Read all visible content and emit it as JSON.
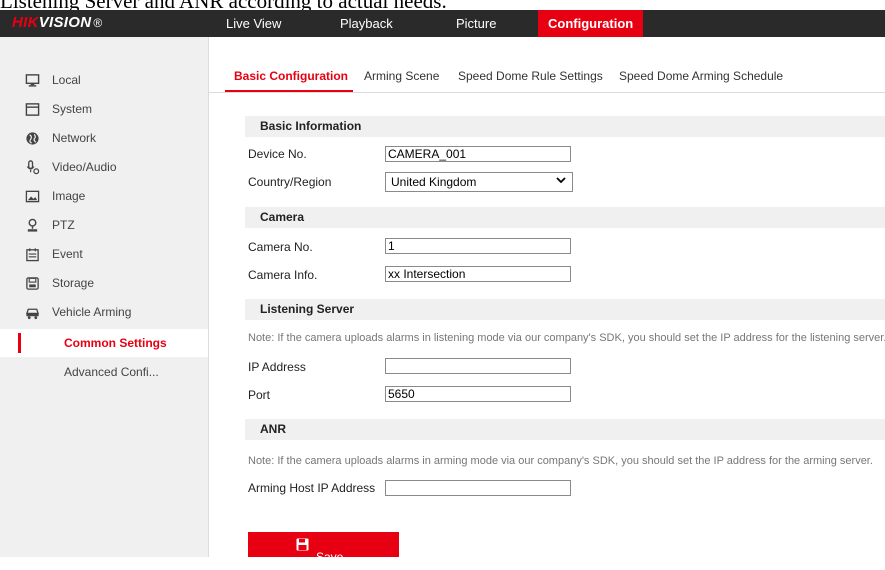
{
  "caption": "Listening Server and ANR according to actual needs.",
  "brand": {
    "logo_red": "HIK",
    "logo_white": "VISION",
    "reg": "®"
  },
  "topnav": [
    {
      "label": "Live View"
    },
    {
      "label": "Playback"
    },
    {
      "label": "Picture"
    },
    {
      "label": "Configuration",
      "active": true
    }
  ],
  "sidebar": {
    "items": [
      {
        "label": "Local",
        "icon": "monitor-icon"
      },
      {
        "label": "System",
        "icon": "system-icon"
      },
      {
        "label": "Network",
        "icon": "globe-icon"
      },
      {
        "label": "Video/Audio",
        "icon": "microphone-icon"
      },
      {
        "label": "Image",
        "icon": "image-icon"
      },
      {
        "label": "PTZ",
        "icon": "ptz-icon"
      },
      {
        "label": "Event",
        "icon": "calendar-icon"
      },
      {
        "label": "Storage",
        "icon": "storage-icon"
      },
      {
        "label": "Vehicle Arming",
        "icon": "vehicle-icon"
      }
    ],
    "subitems": [
      {
        "label": "Common Settings",
        "active": true
      },
      {
        "label": "Advanced Confi..."
      }
    ]
  },
  "tabs": [
    {
      "label": "Basic Configuration",
      "active": true
    },
    {
      "label": "Arming Scene"
    },
    {
      "label": "Speed Dome Rule Settings"
    },
    {
      "label": "Speed Dome Arming Schedule"
    }
  ],
  "basic_info": {
    "title": "Basic Information",
    "device_no_label": "Device No.",
    "device_no_value": "CAMERA_001",
    "country_label": "Country/Region",
    "country_value": "United Kingdom"
  },
  "camera": {
    "title": "Camera",
    "camera_no_label": "Camera No.",
    "camera_no_value": "1",
    "camera_info_label": "Camera Info.",
    "camera_info_value": "xx Intersection"
  },
  "listening_server": {
    "title": "Listening Server",
    "note": "Note: If the camera uploads alarms in listening mode via our company's SDK, you should set the IP address for the listening server.",
    "ip_label": "IP Address",
    "ip_value": "",
    "port_label": "Port",
    "port_value": "5650"
  },
  "anr": {
    "title": "ANR",
    "note": "Note: If the camera uploads alarms in arming mode via our company's SDK, you should set the IP address for the arming server.",
    "host_label": "Arming Host IP Address",
    "host_value": ""
  },
  "save_label": "Save",
  "colors": {
    "accent": "#e60012",
    "topbar": "#2a2a2a",
    "sidebar": "#f0f0f0",
    "section": "#f0f0f0"
  }
}
